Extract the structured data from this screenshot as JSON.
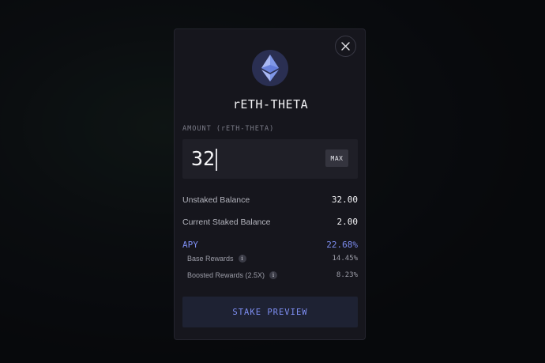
{
  "modal": {
    "token_name": "rETH-THETA",
    "amount_label": "AMOUNT (rETH-THETA)",
    "amount_value": "32",
    "max_label": "MAX",
    "balances": [
      {
        "label": "Unstaked Balance",
        "value": "32.00"
      },
      {
        "label": "Current Staked Balance",
        "value": "2.00"
      }
    ],
    "apy": {
      "label": "APY",
      "value": "22.68%"
    },
    "rewards": [
      {
        "label": "Base Rewards",
        "value": "14.45%"
      },
      {
        "label": "Boosted Rewards (2.5X)",
        "value": "8.23%"
      }
    ],
    "info_glyph": "i",
    "stake_button_label": "STAKE PREVIEW"
  },
  "colors": {
    "accent": "#7e8ef2",
    "modal_bg": "#16161d",
    "eth_logo_bg": "#2a2f52"
  },
  "icons": {
    "close": "close-icon",
    "token": "ethereum-icon",
    "info": "info-icon"
  }
}
